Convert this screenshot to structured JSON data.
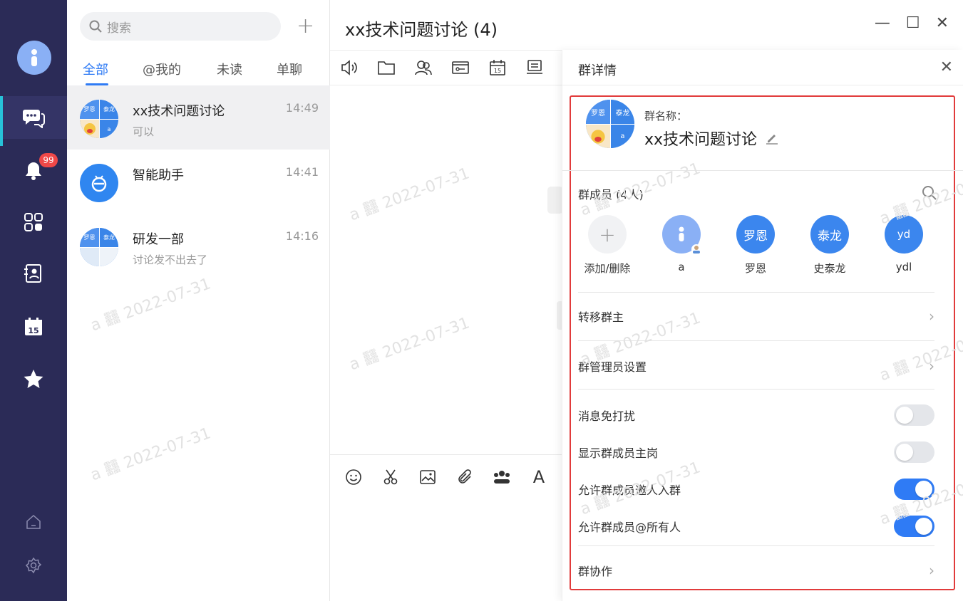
{
  "nav": {
    "badge_count": "99",
    "icons": [
      "user-avatar",
      "chat-icon",
      "bell-icon",
      "apps-icon",
      "contacts-icon",
      "calendar-icon",
      "star-icon",
      "home-icon",
      "settings-icon"
    ],
    "calendar_day": "15",
    "accent_color": "#27c2d8"
  },
  "list": {
    "search_placeholder": "搜索",
    "add_symbol": "+",
    "tabs": [
      {
        "label": "全部",
        "active": true
      },
      {
        "label": "@我的",
        "active": false
      },
      {
        "label": "未读",
        "active": false
      },
      {
        "label": "单聊",
        "active": false
      }
    ],
    "conversations": [
      {
        "name": "xx技术问题讨论",
        "time": "14:49",
        "preview": "可以",
        "selected": true,
        "avatar_labels": [
          "罗恩",
          "泰龙",
          "",
          "a"
        ]
      },
      {
        "name": "智能助手",
        "time": "14:41",
        "preview": "",
        "selected": false
      },
      {
        "name": "研发一部",
        "time": "14:16",
        "preview": "讨论发不出去了",
        "selected": false,
        "avatar_labels": [
          "罗恩",
          "泰龙",
          "",
          ""
        ]
      }
    ]
  },
  "chat": {
    "title": "xx技术问题讨论 (4)",
    "window_buttons": [
      "—",
      "☐",
      "✕"
    ],
    "toolbar_calendar_day": "15",
    "composer_font_icon": "A"
  },
  "watermark": "a 䨻 2022-07-31",
  "detail": {
    "title": "群详情",
    "close": "✕",
    "group_name_label": "群名称：",
    "group_name": "xx技术问题讨论",
    "avatar_labels": [
      "罗恩",
      "泰龙",
      "",
      "a"
    ],
    "members_label": "群成员 (4人)",
    "members": [
      {
        "avatar": "+",
        "name": "添加/删除",
        "kind": "add"
      },
      {
        "avatar": "",
        "name": "a",
        "kind": "light"
      },
      {
        "avatar": "罗恩",
        "name": "罗恩",
        "kind": "normal"
      },
      {
        "avatar": "泰龙",
        "name": "史泰龙",
        "kind": "normal"
      },
      {
        "avatar": "yd",
        "name": "ydl",
        "kind": "normal"
      }
    ],
    "transfer_owner": "转移群主",
    "admin_settings": "群管理员设置",
    "toggles": [
      {
        "label": "消息免打扰",
        "on": false
      },
      {
        "label": "显示群成员主岗",
        "on": false
      },
      {
        "label": "允许群成员邀人入群",
        "on": true
      },
      {
        "label": "允许群成员@所有人",
        "on": true
      }
    ],
    "collaboration": "群协作",
    "chevron": "›",
    "highlight_color": "#e13b3b",
    "accent_color": "#2f7bf5"
  }
}
